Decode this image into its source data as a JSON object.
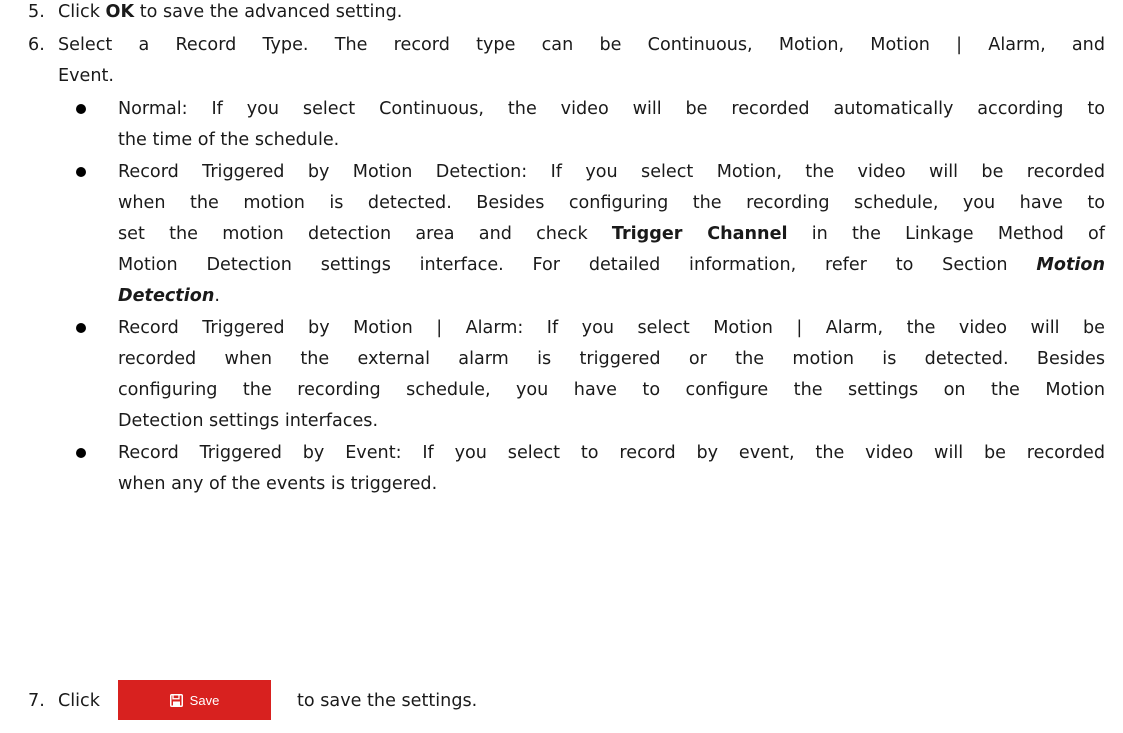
{
  "steps": {
    "s5": {
      "num": "5.",
      "pre": "Click ",
      "bold": "OK",
      "post": " to save the advanced setting."
    },
    "s6": {
      "num": "6.",
      "line1": "Select a Record Type. The record type can be Continuous, Motion, Motion | Alarm, and",
      "line2": "Event."
    },
    "s7": {
      "num": "7.",
      "pre": "Click",
      "post": "to save the settings."
    }
  },
  "bullets": {
    "b1": {
      "l1": "Normal: If you select Continuous, the video will be recorded automatically according to",
      "l2": "the time of the schedule."
    },
    "b2": {
      "l1": "Record Triggered by Motion Detection: If you select Motion, the video will be recorded",
      "l2": "when the motion is detected. Besides configuring the recording schedule, you have to",
      "l3_pre": "set the motion detection area and check ",
      "l3_bold": "Trigger Channel",
      "l3_post": " in the Linkage Method of",
      "l4_pre": "Motion Detection settings interface. For detailed information, refer to Section ",
      "l4_boldit": "Motion",
      "l5_boldit": "Detection",
      "l5_post": "."
    },
    "b3": {
      "l1": "Record Triggered by Motion | Alarm: If you select Motion | Alarm, the video will be",
      "l2": "recorded when the external alarm is triggered or the motion is detected. Besides",
      "l3": "configuring the recording schedule, you have to configure the settings on the Motion",
      "l4": "Detection settings interfaces."
    },
    "b4": {
      "l1": "Record Triggered by Event: If you select to record by event, the video will be recorded",
      "l2": "when any of the events is triggered."
    }
  },
  "save_button": {
    "label": "Save",
    "icon": "save-icon",
    "color": "#d8211f"
  }
}
